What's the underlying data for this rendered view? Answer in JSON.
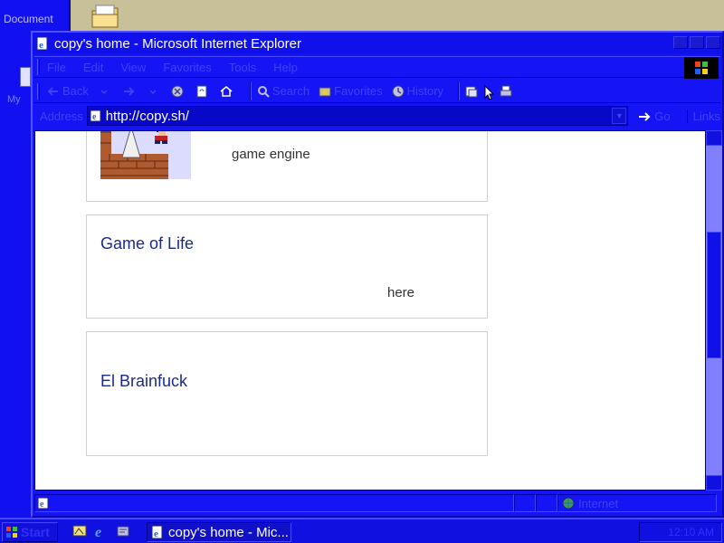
{
  "desktop": {
    "bg_window_title": "Document",
    "desk_icon_label": "My"
  },
  "window": {
    "title": "copy's home - Microsoft Internet Explorer"
  },
  "menu": [
    "File",
    "Edit",
    "View",
    "Favorites",
    "Tools",
    "Help"
  ],
  "toolbar": {
    "back": "Back",
    "search": "Search",
    "favorites": "Favorites",
    "history": "History"
  },
  "address": {
    "label": "Address",
    "value": "http://copy.sh/",
    "go": "Go",
    "links": "Links"
  },
  "content": {
    "cards": [
      {
        "title": "",
        "text": "game engine"
      },
      {
        "title": "Game of Life",
        "text": "here"
      },
      {
        "title": "El Brainfuck",
        "text": ""
      }
    ]
  },
  "status": {
    "zone": "Internet"
  },
  "taskbar": {
    "start": "Start",
    "task_title": "copy's home - Mic...",
    "clock": "12:10 AM"
  },
  "colors": {
    "window_blue": "#1010f0",
    "card_title": "#1a2a8c",
    "scroll_track": "#8080ff"
  }
}
